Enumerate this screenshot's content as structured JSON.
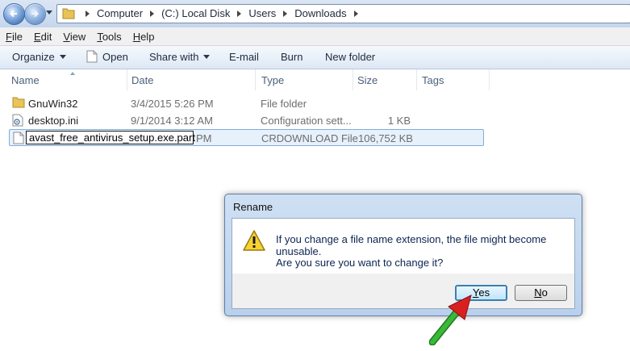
{
  "address_bar": {
    "crumbs": [
      "Computer",
      "(C:) Local Disk",
      "Users",
      "Downloads"
    ]
  },
  "menu": {
    "items": [
      {
        "first": "F",
        "rest": "ile"
      },
      {
        "first": "E",
        "rest": "dit"
      },
      {
        "first": "V",
        "rest": "iew"
      },
      {
        "first": "T",
        "rest": "ools"
      },
      {
        "first": "H",
        "rest": "elp"
      }
    ]
  },
  "toolbar": {
    "organize": "Organize",
    "open": "Open",
    "share_with": "Share with",
    "email": "E-mail",
    "burn": "Burn",
    "new_folder": "New folder"
  },
  "columns": {
    "name": "Name",
    "date": "Date",
    "type": "Type",
    "size": "Size",
    "tags": "Tags"
  },
  "files": [
    {
      "name": "GnuWin32",
      "date": "3/4/2015 5:26 PM",
      "type": "File folder",
      "size": "",
      "icon": "folder-icon"
    },
    {
      "name": "desktop.ini",
      "date": "9/1/2014 3:12 AM",
      "type": "Configuration sett...",
      "size": "1 KB",
      "icon": "settings-file-icon"
    },
    {
      "name": "avast_free_antivirus_setup.exe.part",
      "date": "PM",
      "type": "CRDOWNLOAD File",
      "size": "106,752 KB",
      "icon": "file-icon"
    }
  ],
  "dialog": {
    "title": "Rename",
    "message": "If you change a file name extension, the file might become unusable.",
    "question": "Are you sure you want to change it?",
    "yes_first": "Y",
    "yes_rest": "es",
    "no_first": "N",
    "no_rest": "o"
  },
  "colors": {
    "accent": "#3c7fb1",
    "selection": "#e7f1fc",
    "arrow": "#2fa82f"
  }
}
